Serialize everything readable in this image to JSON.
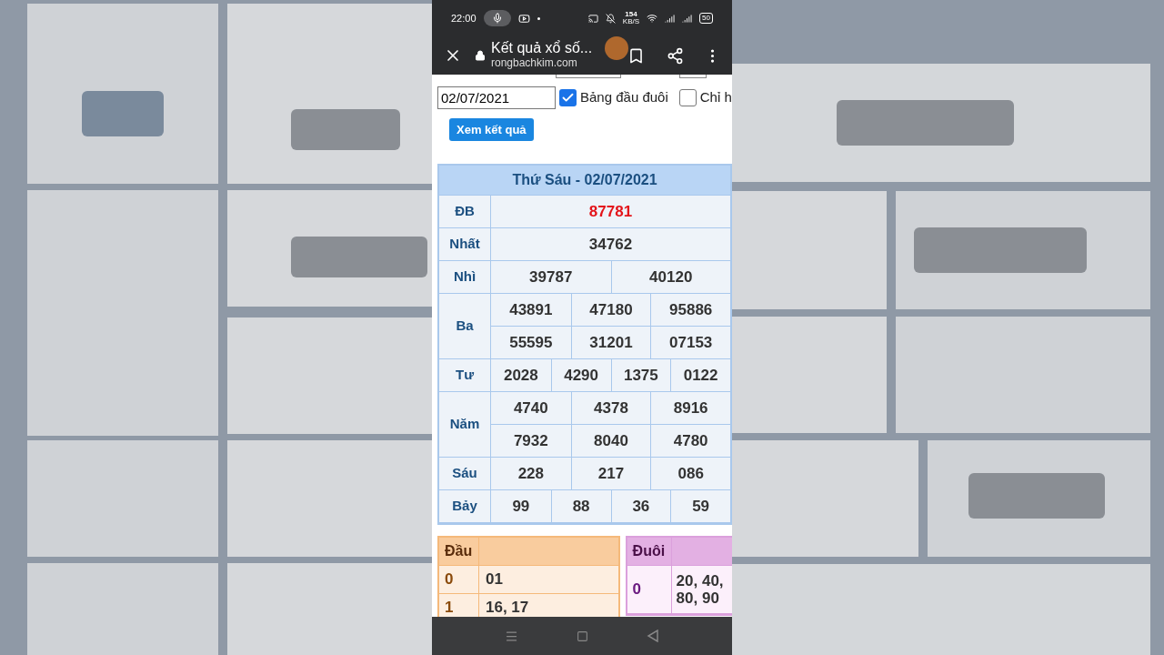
{
  "status_bar": {
    "time": "22:00",
    "net_speed": "154",
    "net_unit": "KB/S",
    "battery": "50"
  },
  "browser": {
    "title": "Kết quả xổ số...",
    "url": "rongbachkim.com"
  },
  "form": {
    "date": "02/07/2021",
    "checkboxes": [
      {
        "label": "Bảng đầu đuôi",
        "checked": true
      },
      {
        "label": "Chỉ h",
        "checked": false
      }
    ],
    "button": "Xem kết quả"
  },
  "results": {
    "title": "Thứ Sáu - 02/07/2021",
    "prizes": [
      {
        "label": "ĐB",
        "highlight": true,
        "lines": [
          [
            "87781"
          ]
        ]
      },
      {
        "label": "Nhất",
        "highlight": false,
        "lines": [
          [
            "34762"
          ]
        ]
      },
      {
        "label": "Nhì",
        "highlight": false,
        "lines": [
          [
            "39787",
            "40120"
          ]
        ]
      },
      {
        "label": "Ba",
        "highlight": false,
        "lines": [
          [
            "43891",
            "47180",
            "95886"
          ],
          [
            "55595",
            "31201",
            "07153"
          ]
        ]
      },
      {
        "label": "Tư",
        "highlight": false,
        "lines": [
          [
            "2028",
            "4290",
            "1375",
            "0122"
          ]
        ]
      },
      {
        "label": "Năm",
        "highlight": false,
        "lines": [
          [
            "4740",
            "4378",
            "8916"
          ],
          [
            "7932",
            "8040",
            "4780"
          ]
        ]
      },
      {
        "label": "Sáu",
        "highlight": false,
        "lines": [
          [
            "228",
            "217",
            "086"
          ]
        ]
      },
      {
        "label": "Bảy",
        "highlight": false,
        "lines": [
          [
            "99",
            "88",
            "36",
            "59"
          ]
        ]
      }
    ]
  },
  "dau": {
    "header": "Đầu",
    "rows": [
      {
        "key": "0",
        "value": "01"
      },
      {
        "key": "1",
        "value": "16, 17"
      }
    ]
  },
  "duoi": {
    "header": "Đuôi",
    "rows": [
      {
        "key": "0",
        "value": "20, 40, 80, 90"
      }
    ]
  }
}
